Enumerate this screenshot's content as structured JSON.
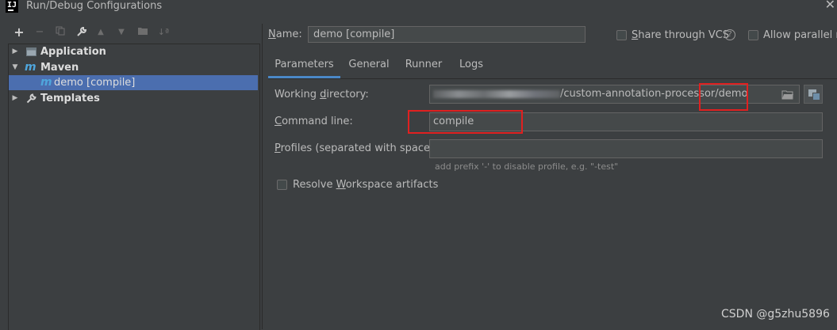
{
  "window": {
    "title": "Run/Debug Configurations",
    "close_glyph": "✕",
    "app_icon_text": "IJ"
  },
  "toolbar": {
    "add": "+",
    "remove": "−",
    "copy": "⧉",
    "edit": "🔧",
    "up": "▲",
    "down": "▼",
    "folder": "▇",
    "sort": "↓ª"
  },
  "tree": {
    "items": [
      {
        "label": "Application",
        "icon": "application-icon",
        "expanded": false
      },
      {
        "label": "Maven",
        "icon": "maven-icon",
        "icon_glyph": "m",
        "expanded": true
      },
      {
        "label": "demo [compile]",
        "icon": "maven-icon",
        "icon_glyph": "m",
        "selected": true
      },
      {
        "label": "Templates",
        "icon": "wrench-icon",
        "expanded": false
      }
    ]
  },
  "name": {
    "label_underlined": "N",
    "label_rest": "ame:",
    "value": "demo [compile]"
  },
  "share_vcs": {
    "label_underlined": "S",
    "label_rest": "hare through VCS",
    "checked": false,
    "help": "?"
  },
  "allow_parallel": {
    "label": "Allow parallel ru",
    "checked": false
  },
  "tabs": [
    {
      "label": "Parameters",
      "selected": true
    },
    {
      "label": "General",
      "selected": false
    },
    {
      "label": "Runner",
      "selected": false
    },
    {
      "label": "Logs",
      "selected": false
    }
  ],
  "parameters": {
    "working_directory": {
      "label_before": "Working ",
      "label_underlined": "d",
      "label_after": "irectory:",
      "value_visible": "/custom-annotation-processor/demo"
    },
    "command_line": {
      "label_underlined": "C",
      "label_rest": "ommand line:",
      "value": "compile"
    },
    "profiles": {
      "label_underlined": "P",
      "label_rest": "rofiles (separated with space):",
      "value": "",
      "hint": "add prefix '-' to disable profile, e.g. \"-test\""
    },
    "resolve_workspace": {
      "label_before": "Resolve ",
      "label_underlined": "W",
      "label_after": "orkspace artifacts",
      "checked": false
    }
  },
  "watermark": "CSDN @g5zhu5896",
  "colors": {
    "background": "#3c3f41",
    "selection": "#4b6eaf",
    "tab_underline": "#4a88c7",
    "highlight_box": "#e02020",
    "maven": "#4fa6dc"
  }
}
